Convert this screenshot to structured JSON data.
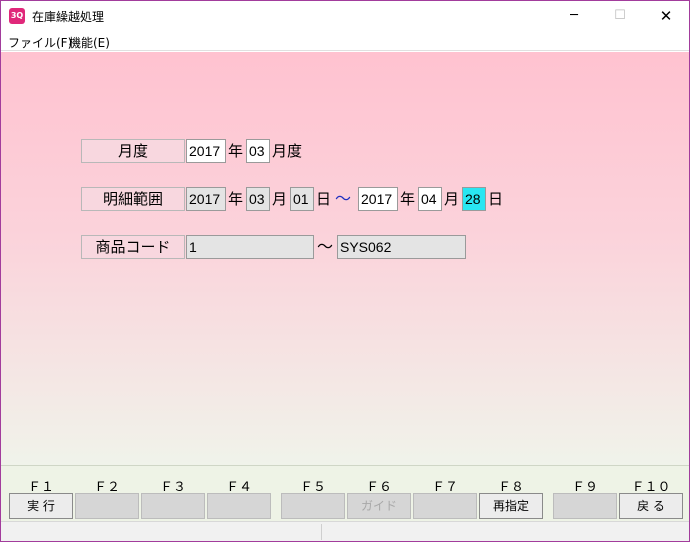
{
  "window": {
    "title": "在庫繰越処理",
    "icon_text": "3Q"
  },
  "titlebar": {
    "minimize": "─",
    "maximize": "☐",
    "close": "✕"
  },
  "menu": {
    "file": "ファイル(F)",
    "function": "機能(E)"
  },
  "form": {
    "month": {
      "label": "月度",
      "year": "2017",
      "year_unit": "年",
      "month": "03",
      "month_unit": "月度"
    },
    "detail_range": {
      "label": "明細範囲",
      "from_year": "2017",
      "from_month": "03",
      "from_day": "01",
      "separator": "～",
      "to_year": "2017",
      "to_month": "04",
      "to_day": "28",
      "year_unit": "年",
      "month_unit": "月",
      "day_unit": "日"
    },
    "product_code": {
      "label": "商品コード",
      "from": "1",
      "separator": "～",
      "to": "SYS062"
    }
  },
  "fkeys": [
    {
      "key": "Ｆ１",
      "label": "実 行"
    },
    {
      "key": "Ｆ２",
      "label": ""
    },
    {
      "key": "Ｆ３",
      "label": ""
    },
    {
      "key": "Ｆ４",
      "label": ""
    },
    {
      "key": "Ｆ５",
      "label": ""
    },
    {
      "key": "Ｆ６",
      "label": "ガイド"
    },
    {
      "key": "Ｆ７",
      "label": ""
    },
    {
      "key": "Ｆ８",
      "label": "再指定"
    },
    {
      "key": "Ｆ９",
      "label": ""
    },
    {
      "key": "Ｆ１０",
      "label": "戻 る"
    }
  ],
  "colors": {
    "border": "#a23c9c",
    "highlight": "#29e6f2",
    "tilde": "#2030c0"
  }
}
